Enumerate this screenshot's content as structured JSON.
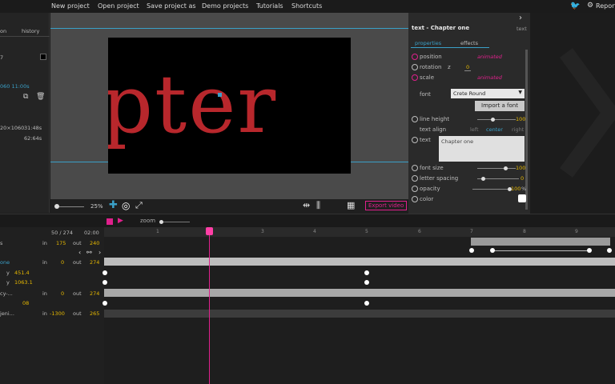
{
  "menu": {
    "items": [
      "New project",
      "Open project",
      "Save project as",
      "Demo projects",
      "Tutorials",
      "Shortcuts"
    ],
    "report_label": "Report"
  },
  "left_panel": {
    "tab_history": "history",
    "tab_other": "on",
    "time_range": "060 11:00s",
    "resolution": "20×1060",
    "duration_a": "31:48s",
    "duration_b": "62:64s",
    "num": "7"
  },
  "viewport": {
    "stage_text": "pter",
    "zoom_percent": "25%",
    "export_label": "Export video"
  },
  "right_panel": {
    "title": "text - Chapter one",
    "side_label": "text",
    "tab_properties": "properties",
    "tab_effects": "effects",
    "position_label": "position",
    "position_state": "animated",
    "rotation_label": "rotation",
    "rotation_axis": "z",
    "rotation_value": "0",
    "scale_label": "scale",
    "scale_state": "animated",
    "font_label": "font",
    "font_value": "Crete Round",
    "import_font_label": "Import a font",
    "line_height_label": "line height",
    "line_height_value": "100",
    "text_align_label": "text align",
    "align_left": "left",
    "align_center": "center",
    "align_right": "right",
    "text_label": "text",
    "text_value": "Chapter one",
    "font_size_label": "font size",
    "font_size_value": "100",
    "letter_spacing_label": "letter spacing",
    "letter_spacing_value": "0",
    "opacity_label": "opacity",
    "opacity_value": "100",
    "opacity_unit": "%",
    "color_label": "color"
  },
  "timeline": {
    "frame_counter": "50 / 274",
    "time_display": "02:00",
    "zoom_label": "zoom",
    "ruler_ticks": [
      "1",
      "2",
      "3",
      "4",
      "5",
      "6",
      "7",
      "8",
      "9"
    ],
    "rows": [
      {
        "label": "s",
        "in_label": "in",
        "in": "175",
        "out_label": "out",
        "out": "240"
      },
      {
        "label": "one",
        "in_label": "in",
        "in": "0",
        "out_label": "out",
        "out": "274"
      },
      {
        "label": "y",
        "value": "451.4"
      },
      {
        "label": "y",
        "value": "1063.1"
      },
      {
        "label": "cy-...",
        "in_label": "in",
        "in": "0",
        "out_label": "out",
        "out": "274"
      },
      {
        "label": "",
        "value": "08"
      },
      {
        "label": "jeni...",
        "in_label": "in",
        "in": "-1300",
        "out_label": "out",
        "out": "265"
      }
    ]
  }
}
